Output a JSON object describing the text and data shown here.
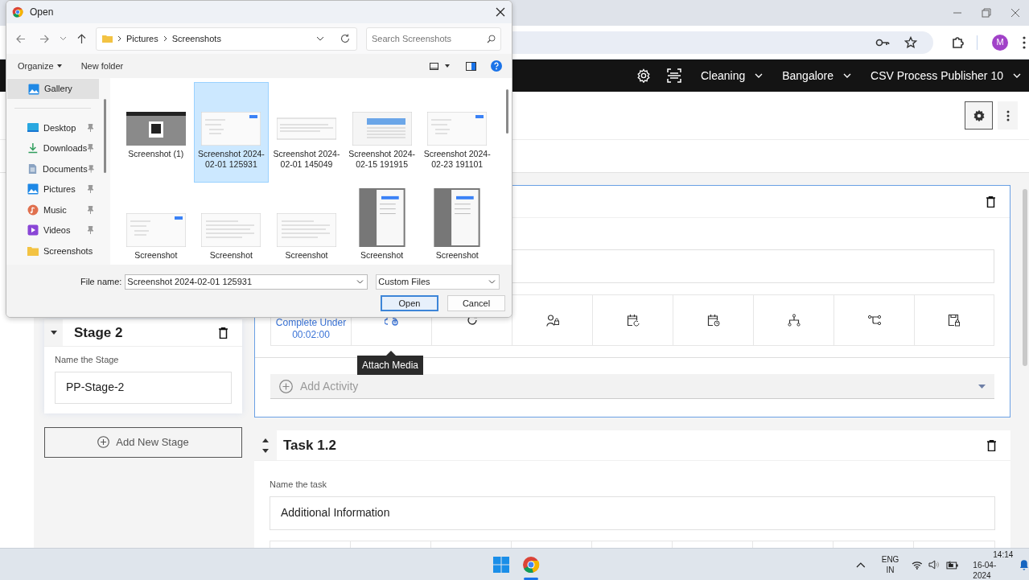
{
  "browser": {
    "profile_initial": "M"
  },
  "app_nav": {
    "menus": [
      {
        "label": "Cleaning"
      },
      {
        "label": "Bangalore"
      },
      {
        "label": "CSV Process Publisher 10"
      }
    ]
  },
  "stage": {
    "title": "Stage 2",
    "field_label": "Name the Stage",
    "value": "PP-Stage-2"
  },
  "add_stage": "Add New Stage",
  "task_1": {
    "timer_label": "Complete Under",
    "timer_value": "00:02:00",
    "tooltip": "Attach Media",
    "add_activity": "Add Activity"
  },
  "task_2": {
    "title": "Task 1.2",
    "field_label": "Name the task",
    "value": "Additional Information"
  },
  "dialog": {
    "title": "Open",
    "breadcrumb": [
      "Pictures",
      "Screenshots"
    ],
    "search_placeholder": "Search Screenshots",
    "toolbar": [
      "Organize",
      "New folder"
    ],
    "nav_items": [
      {
        "label": "Gallery",
        "kind": "gallery",
        "pinned": false,
        "selected": true
      },
      {
        "label": "Desktop",
        "kind": "desktop",
        "pinned": true,
        "selected": false
      },
      {
        "label": "Downloads",
        "kind": "downloads",
        "pinned": true,
        "selected": false
      },
      {
        "label": "Documents",
        "kind": "documents",
        "pinned": true,
        "selected": false
      },
      {
        "label": "Pictures",
        "kind": "pictures",
        "pinned": true,
        "selected": false
      },
      {
        "label": "Music",
        "kind": "music",
        "pinned": true,
        "selected": false
      },
      {
        "label": "Videos",
        "kind": "videos",
        "pinned": true,
        "selected": false
      },
      {
        "label": "Screenshots",
        "kind": "folder",
        "pinned": false,
        "selected": false
      }
    ],
    "files": [
      {
        "name": "Screenshot (1)",
        "kind": "dark",
        "selected": false
      },
      {
        "name": "Screenshot 2024-02-01 125931",
        "kind": "wide",
        "selected": true
      },
      {
        "name": "Screenshot 2024-02-01 145049",
        "kind": "short",
        "selected": false
      },
      {
        "name": "Screenshot 2024-02-15 191915",
        "kind": "table",
        "selected": false
      },
      {
        "name": "Screenshot 2024-02-23 191101",
        "kind": "wide",
        "selected": false
      },
      {
        "name": "Screenshot",
        "kind": "wide",
        "selected": false
      },
      {
        "name": "Screenshot",
        "kind": "doc",
        "selected": false
      },
      {
        "name": "Screenshot",
        "kind": "doc",
        "selected": false
      },
      {
        "name": "Screenshot",
        "kind": "phone",
        "selected": false
      },
      {
        "name": "Screenshot",
        "kind": "phone",
        "selected": false
      }
    ],
    "file_name_label": "File name:",
    "file_name": "Screenshot 2024-02-01 125931",
    "file_type": "Custom Files",
    "buttons": [
      "Open",
      "Cancel"
    ]
  },
  "taskbar": {
    "language": "ENG",
    "region": "IN",
    "time": "14:14",
    "date": "16-04-2024"
  }
}
